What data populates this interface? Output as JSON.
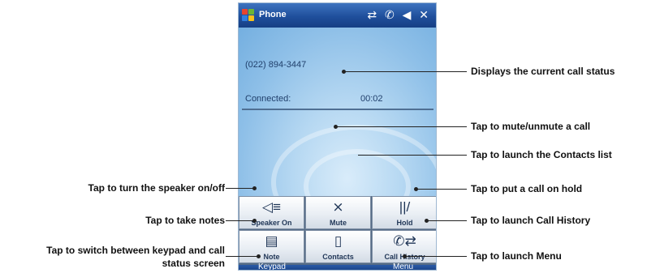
{
  "app": {
    "title": "Phone",
    "status_icons": "⇄ ✆ ◀ ✕"
  },
  "call": {
    "number": "(022) 894-3447",
    "status_label": "Connected:",
    "duration": "00:02"
  },
  "buttons": [
    {
      "label": "Speaker On",
      "icon": "speaker-icon",
      "glyph": "◁≡"
    },
    {
      "label": "Mute",
      "icon": "microphone-muted-icon",
      "glyph": "⨯"
    },
    {
      "label": "Hold",
      "icon": "hold-icon",
      "glyph": "||/"
    },
    {
      "label": "Note",
      "icon": "note-icon",
      "glyph": "▤"
    },
    {
      "label": "Contacts",
      "icon": "contacts-icon",
      "glyph": "▯"
    },
    {
      "label": "Call History",
      "icon": "call-history-icon",
      "glyph": "✆⇄"
    }
  ],
  "softkeys": {
    "left": "Keypad",
    "right": "Menu"
  },
  "callouts": {
    "call_status": "Displays the current call status",
    "mute": "Tap to mute/unmute a call",
    "contacts": "Tap to launch the Contacts list",
    "speaker": "Tap to turn the speaker on/off",
    "hold": "Tap to put a call on hold",
    "note": "Tap to take notes",
    "call_history": "Tap to launch Call History",
    "keypad_line1": "Tap to switch between keypad and call",
    "keypad_line2": "status screen",
    "menu": "Tap to launch Menu"
  },
  "colors": {
    "titlebar": "#1f4f9c",
    "screen": "#b6d8f2",
    "flag": [
      "#e8452e",
      "#6bb535",
      "#2f7ee0",
      "#f7c11a"
    ]
  }
}
